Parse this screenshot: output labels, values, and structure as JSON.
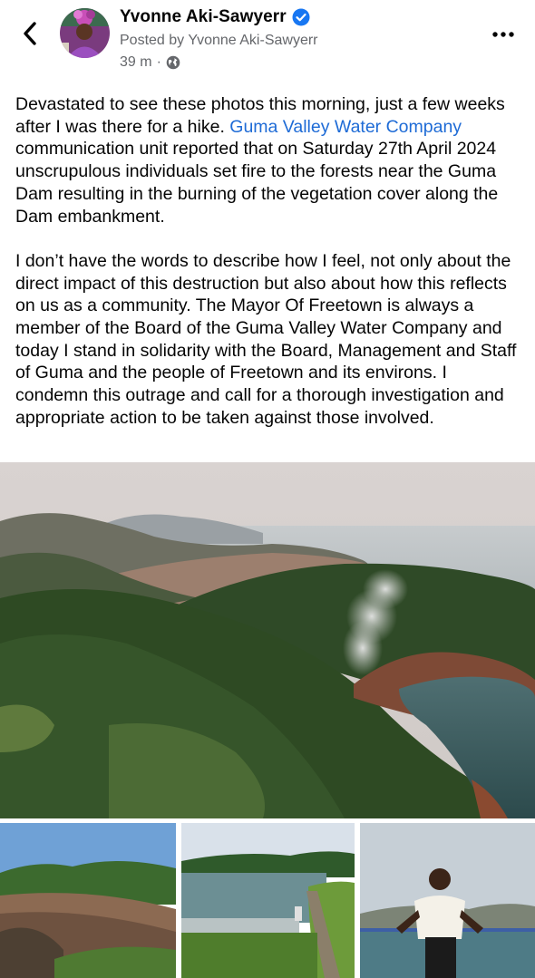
{
  "header": {
    "author_name": "Yvonne Aki-Sawyerr",
    "posted_by": "Posted by Yvonne Aki-Sawyerr",
    "time": "39 m",
    "separator": "·",
    "icons": {
      "back": "back-arrow-icon",
      "verified": "verified-badge-icon",
      "audience": "globe-icon",
      "more": "more-options-icon"
    },
    "verified_color": "#1877f2"
  },
  "post": {
    "p1_before": "Devastated to see these photos this morning, just a few weeks after I was there for a hike. ",
    "p1_link": "Guma Valley Water Company",
    "p1_after": " communication unit reported that on Saturday 27th April 2024 unscrupulous individuals set fire to the forests near the Guma Dam resulting in the burning of the vegetation cover along the Dam embankment.",
    "p2": "I don’t have the words to describe how I feel, not only about the direct impact of this destruction but also about how this reflects on us as a community. The Mayor Of Freetown is always a member of the Board of the Guma Valley Water Company and today I stand in solidarity with the Board, Management and Staff of Guma and the people of Freetown and its environs. I condemn this outrage and call for a thorough investigation and appropriate action to be taken against those involved.",
    "link_color": "#1e6bd6"
  },
  "photos": {
    "main": "aerial-forest-dam-smoke-photo",
    "thumbnails": [
      "burnt-embankment-photo",
      "dam-spillway-photo",
      "woman-at-railing-photo"
    ]
  }
}
